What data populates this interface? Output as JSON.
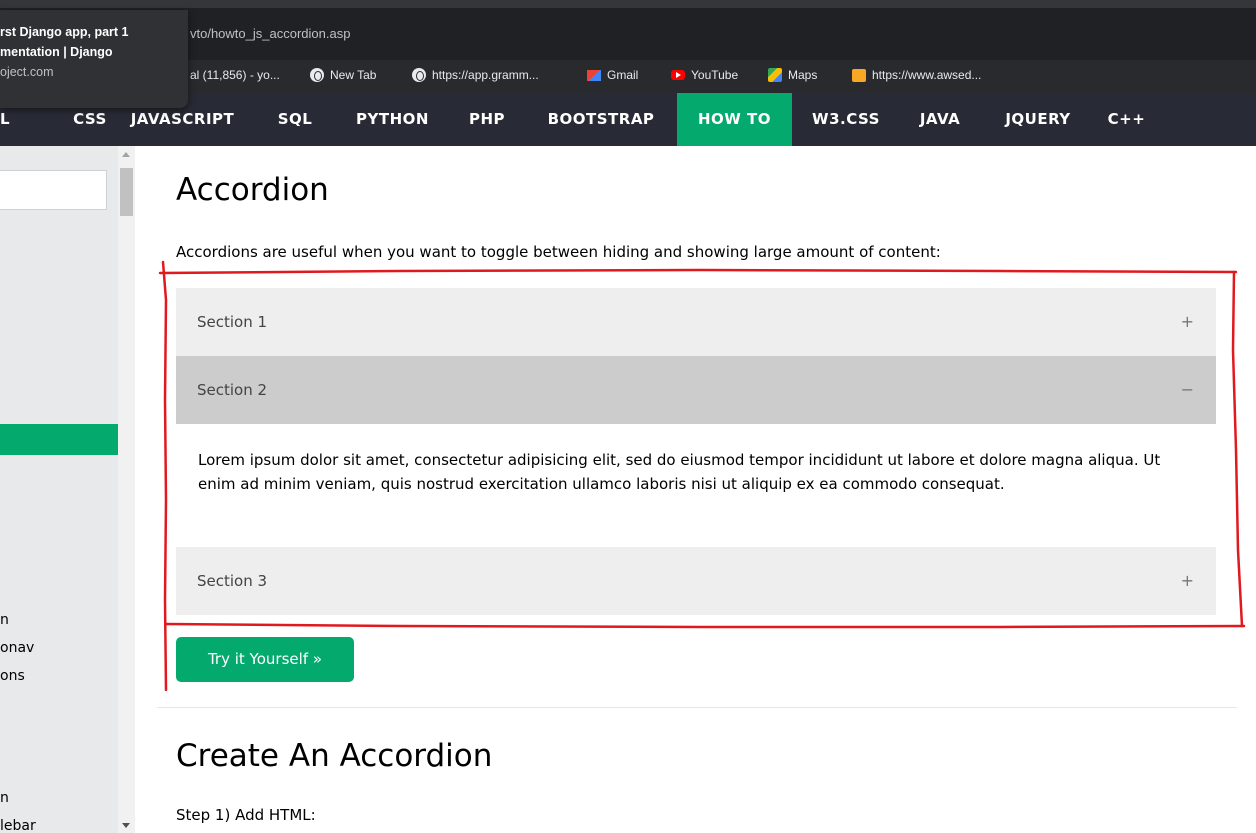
{
  "browser": {
    "url": "vto/howto_js_accordion.asp",
    "bookmarks": [
      {
        "label": "al (11,856) - yo...",
        "icon": "none"
      },
      {
        "label": "New Tab",
        "icon": "globe-icon"
      },
      {
        "label": "https://app.gramm...",
        "icon": "globe-icon"
      },
      {
        "label": "Gmail",
        "icon": "gmail-icon"
      },
      {
        "label": "YouTube",
        "icon": "youtube-icon"
      },
      {
        "label": "Maps",
        "icon": "maps-icon"
      },
      {
        "label": "https://www.awsed...",
        "icon": "gift-icon"
      }
    ]
  },
  "tab_tooltip": {
    "line1": "rst Django app, part 1",
    "line2": "mentation | Django",
    "domain": "oject.com"
  },
  "topnav": {
    "items": [
      "L",
      "CSS",
      "JAVASCRIPT",
      "SQL",
      "PYTHON",
      "PHP",
      "BOOTSTRAP",
      "HOW TO",
      "W3.CSS",
      "JAVA",
      "JQUERY",
      "C++"
    ],
    "active": "HOW TO",
    "accent": "#04aa6d"
  },
  "sidebar": {
    "fragments": [
      "n",
      "onav",
      "ons",
      "n",
      "lebar"
    ]
  },
  "content": {
    "title": "Accordion",
    "intro": "Accordions are useful when you want to toggle between hiding and showing large amount of content:",
    "sections": [
      {
        "label": "Section 1",
        "sign": "+",
        "open": false
      },
      {
        "label": "Section 2",
        "sign": "−",
        "open": true
      },
      {
        "label": "Section 3",
        "sign": "+",
        "open": false
      }
    ],
    "panel_text": "Lorem ipsum dolor sit amet, consectetur adipisicing elit, sed do eiusmod tempor incididunt ut labore et dolore magna aliqua. Ut enim ad minim veniam, quis nostrud exercitation ullamco laboris nisi ut aliquip ex ea commodo consequat.",
    "try_button": "Try it Yourself »",
    "subtitle": "Create An Accordion",
    "step": "Step 1) Add HTML:"
  },
  "colors": {
    "nav_bg": "#282a35",
    "accordion_bg": "#eeeeee",
    "accordion_active_bg": "#cccccc",
    "annotation": "#e0191f"
  }
}
